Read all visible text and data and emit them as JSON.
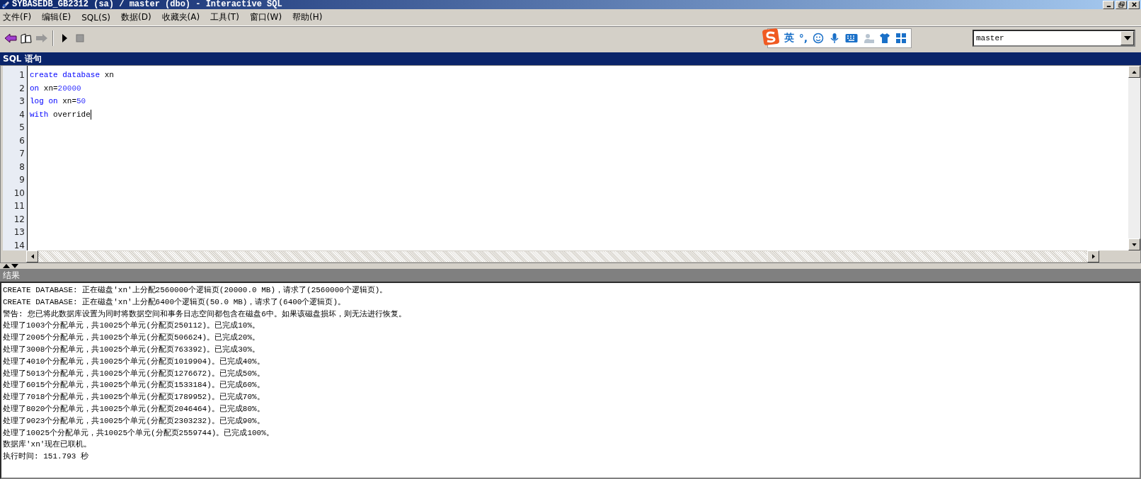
{
  "window": {
    "title": "SYBASEDB_GB2312 (sa) / master (dbo) - Interactive SQL"
  },
  "menu": [
    "文件(F)",
    "编辑(E)",
    "SQL(S)",
    "数据(D)",
    "收藏夹(A)",
    "工具(T)",
    "窗口(W)",
    "帮助(H)"
  ],
  "toolbar": [
    {
      "kind": "back",
      "disabled": false
    },
    {
      "kind": "book",
      "disabled": false
    },
    {
      "kind": "forward",
      "disabled": true
    },
    {
      "kind": "separator"
    },
    {
      "kind": "run",
      "disabled": false
    },
    {
      "kind": "stop",
      "disabled": true
    }
  ],
  "ime": {
    "lang": "英",
    "punct": "°,"
  },
  "database_select": {
    "value": "master"
  },
  "editor": {
    "title": "SQL 语句",
    "line_numbers": [
      "1",
      "2",
      "3",
      "4",
      "5",
      "6",
      "7",
      "8",
      "9",
      "10",
      "11",
      "12",
      "13",
      "14"
    ],
    "lines": [
      [
        {
          "text": "create database",
          "kind": "keyword"
        },
        {
          "text": " xn",
          "kind": "ident"
        }
      ],
      [
        {
          "text": "on",
          "kind": "keyword"
        },
        {
          "text": " xn=",
          "kind": "ident"
        },
        {
          "text": "20000",
          "kind": "number"
        }
      ],
      [
        {
          "text": "log on",
          "kind": "keyword"
        },
        {
          "text": " xn=",
          "kind": "ident"
        },
        {
          "text": "50",
          "kind": "number"
        }
      ],
      [
        {
          "text": "with",
          "kind": "keyword"
        },
        {
          "text": " override",
          "kind": "ident"
        }
      ]
    ]
  },
  "results": {
    "title": "结果",
    "lines": [
      "CREATE DATABASE: 正在磁盘'xn'上分配2560000个逻辑页(20000.0 MB)，请求了(2560000个逻辑页)。",
      "CREATE DATABASE: 正在磁盘'xn'上分配6400个逻辑页(50.0 MB)，请求了(6400个逻辑页)。",
      "警告: 您已将此数据库设置为同时将数据空间和事务日志空间都包含在磁盘6中。如果该磁盘损坏，则无法进行恢复。",
      "处理了1003个分配单元，共10025个单元(分配页250112)。已完成10%。",
      "处理了2005个分配单元，共10025个单元(分配页506624)。已完成20%。",
      "处理了3008个分配单元，共10025个单元(分配页763392)。已完成30%。",
      "处理了4010个分配单元，共10025个单元(分配页1019904)。已完成40%。",
      "处理了5013个分配单元，共10025个单元(分配页1276672)。已完成50%。",
      "处理了6015个分配单元，共10025个单元(分配页1533184)。已完成60%。",
      "处理了7018个分配单元，共10025个单元(分配页1789952)。已完成70%。",
      "处理了8020个分配单元，共10025个单元(分配页2046464)。已完成80%。",
      "处理了9023个分配单元，共10025个单元(分配页2303232)。已完成90%。",
      "处理了10025个分配单元，共10025个单元(分配页2559744)。已完成100%。",
      "数据库'xn'现在已联机。",
      "执行时间: 151.793 秒"
    ]
  }
}
